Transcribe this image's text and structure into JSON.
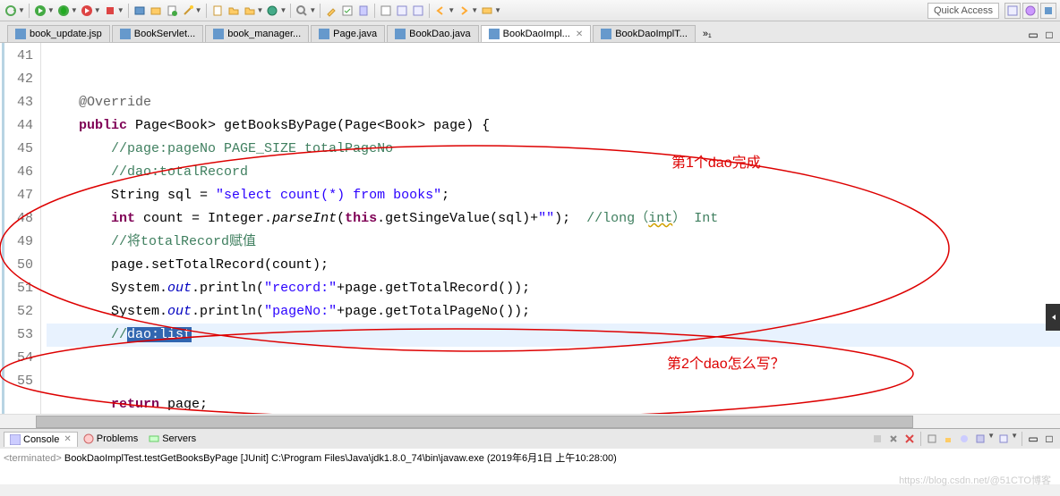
{
  "quick_access": "Quick Access",
  "tabs": [
    {
      "label": "book_update.jsp",
      "type": "jsp"
    },
    {
      "label": "BookServlet...",
      "type": "java"
    },
    {
      "label": "book_manager...",
      "type": "jsp"
    },
    {
      "label": "Page.java",
      "type": "java"
    },
    {
      "label": "BookDao.java",
      "type": "java"
    },
    {
      "label": "BookDaoImpl...",
      "type": "java",
      "active": true
    },
    {
      "label": "BookDaoImplT...",
      "type": "java"
    }
  ],
  "tabs_overflow": "»₁",
  "gutter": [
    "41",
    "42",
    "43",
    "44",
    "45",
    "46",
    "47",
    "48",
    "49",
    "50",
    "51",
    "52",
    "53",
    "54",
    "55"
  ],
  "code": {
    "l42_ann": "@Override",
    "l43_kw1": "public",
    "l43_t1": " Page<Book> getBooksByPage(Page<Book> page) {",
    "l44_com": "//page:pageNo PAGE_SIZE totalPageNo",
    "l45_com": "//dao:totalRecord",
    "l46_t1": "String sql = ",
    "l46_str": "\"select count(*) from books\"",
    "l46_t2": ";",
    "l47_kw1": "int",
    "l47_t1": " count = Integer.",
    "l47_m": "parseInt",
    "l47_t2": "(",
    "l47_kw2": "this",
    "l47_t3": ".getSingeValue(sql)+",
    "l47_str": "\"\"",
    "l47_t4": ");  ",
    "l47_com": "//long",
    "l47_paren": "（",
    "l47_int": "int",
    "l47_paren2": "）",
    "l47_end": " Int",
    "l48_com": "//将totalRecord赋值",
    "l49_t1": "page.setTotalRecord(count);",
    "l50_t1": "System.",
    "l50_out": "out",
    "l50_t2": ".println(",
    "l50_str": "\"record:\"",
    "l50_t3": "+page.getTotalRecord());",
    "l51_t1": "System.",
    "l51_out": "out",
    "l51_t2": ".println(",
    "l51_str": "\"pageNo:\"",
    "l51_t3": "+page.getTotalPageNo());",
    "l52_com": "//",
    "l52_sel": "dao:list",
    "l55_kw": "return",
    "l55_t": " page;"
  },
  "annotations": {
    "a1": "第1个dao完成",
    "a2": "第2个dao怎么写？"
  },
  "console": {
    "tabs": [
      {
        "label": "Console",
        "active": true
      },
      {
        "label": "Problems"
      },
      {
        "label": "Servers"
      }
    ],
    "prefix": "<terminated> ",
    "text": "BookDaoImplTest.testGetBooksByPage [JUnit] C:\\Program Files\\Java\\jdk1.8.0_74\\bin\\javaw.exe (2019年6月1日 上午10:28:00)"
  },
  "watermark": "https://blog.csdn.net/@51CTO博客"
}
